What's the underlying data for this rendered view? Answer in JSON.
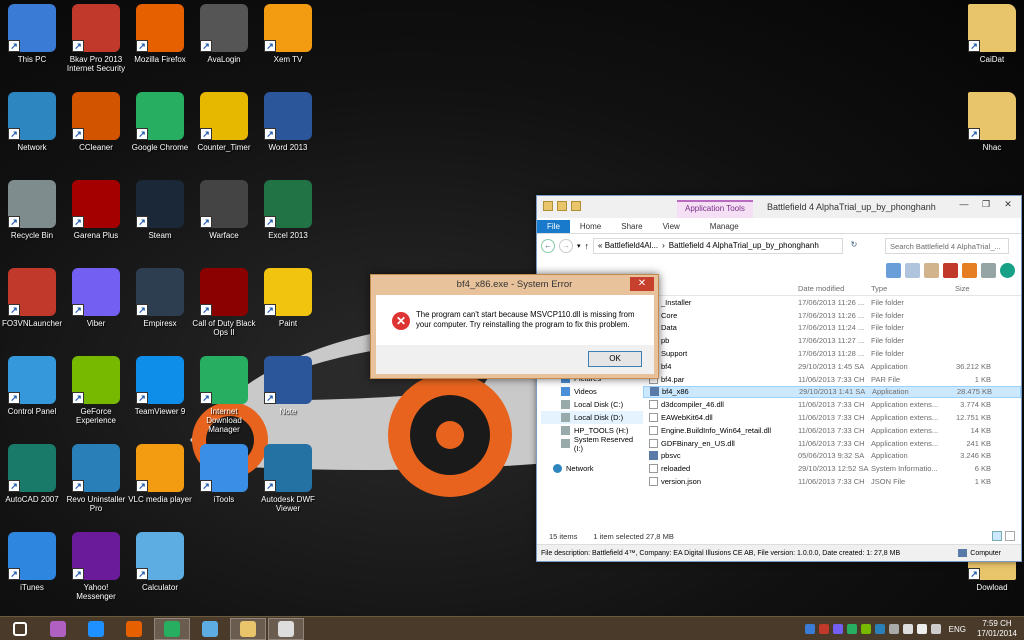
{
  "desktop_icons": [
    {
      "label": "This PC",
      "icon": "computer-icon",
      "color": "#3a7bd5"
    },
    {
      "label": "Bkav Pro 2013 Internet Security",
      "icon": "shield-icon",
      "color": "#c0392b"
    },
    {
      "label": "Mozilla Firefox",
      "icon": "firefox-icon",
      "color": "#e66000"
    },
    {
      "label": "AvaLogin",
      "icon": "avalogin-icon",
      "color": "#555555"
    },
    {
      "label": "Xem TV",
      "icon": "vlc-cone-icon",
      "color": "#f39c12"
    },
    {
      "label": "Network",
      "icon": "network-globe-icon",
      "color": "#2e86c1"
    },
    {
      "label": "CCleaner",
      "icon": "ccleaner-icon",
      "color": "#d35400"
    },
    {
      "label": "Google Chrome",
      "icon": "chrome-icon",
      "color": "#27ae60"
    },
    {
      "label": "Counter_Timer",
      "icon": "alarm-clock-icon",
      "color": "#e6b800"
    },
    {
      "label": "Word 2013",
      "icon": "word-icon",
      "color": "#2b579a"
    },
    {
      "label": "Recycle Bin",
      "icon": "recycle-bin-icon",
      "color": "#7f8c8d"
    },
    {
      "label": "Garena Plus",
      "icon": "garena-icon",
      "color": "#a50000"
    },
    {
      "label": "Steam",
      "icon": "steam-icon",
      "color": "#1b2838"
    },
    {
      "label": "Warface",
      "icon": "warface-icon",
      "color": "#444444"
    },
    {
      "label": "Excel 2013",
      "icon": "excel-icon",
      "color": "#217346"
    },
    {
      "label": "FO3VNLauncher",
      "icon": "fo3-icon",
      "color": "#c0392b"
    },
    {
      "label": "Viber",
      "icon": "viber-icon",
      "color": "#7360f2"
    },
    {
      "label": "Empiresx",
      "icon": "empires-icon",
      "color": "#2c3e50"
    },
    {
      "label": "Call of Duty Black Ops II",
      "icon": "cod-icon",
      "color": "#8b0000"
    },
    {
      "label": "Paint",
      "icon": "paint-palette-icon",
      "color": "#f1c40f"
    },
    {
      "label": "Control Panel",
      "icon": "control-panel-icon",
      "color": "#3498db"
    },
    {
      "label": "GeForce Experience",
      "icon": "geforce-icon",
      "color": "#76b900"
    },
    {
      "label": "TeamViewer 9",
      "icon": "teamviewer-icon",
      "color": "#0e8ee9"
    },
    {
      "label": "Internet Download Manager",
      "icon": "idm-icon",
      "color": "#27ae60"
    },
    {
      "label": "Note",
      "icon": "word-doc-icon",
      "color": "#2b579a"
    },
    {
      "label": "AutoCAD 2007",
      "icon": "autocad-icon",
      "color": "#1a7a6a"
    },
    {
      "label": "Revo Uninstaller Pro",
      "icon": "revo-icon",
      "color": "#2980b9"
    },
    {
      "label": "VLC media player",
      "icon": "vlc-cone-icon",
      "color": "#f39c12"
    },
    {
      "label": "iTools",
      "icon": "itools-icon",
      "color": "#3a8ee6"
    },
    {
      "label": "Autodesk DWF Viewer",
      "icon": "dwf-viewer-icon",
      "color": "#2471a3"
    },
    {
      "label": "iTunes",
      "icon": "itunes-icon",
      "color": "#2e86de"
    },
    {
      "label": "Yahoo! Messenger",
      "icon": "yahoo-icon",
      "color": "#6a1b9a"
    },
    {
      "label": "Calculator",
      "icon": "calculator-icon",
      "color": "#5dade2"
    },
    {
      "label": "CaiDat",
      "icon": "folder-icon",
      "color": "#e8c46a"
    },
    {
      "label": "Nhac",
      "icon": "folder-icon",
      "color": "#e8c46a"
    },
    {
      "label": "Dowload",
      "icon": "folder-icon",
      "color": "#e8c46a"
    }
  ],
  "explorer": {
    "title": "Battlefield 4 AlphaTrial_up_by_phonghanh",
    "app_tools_tab": "Application Tools",
    "tabs": [
      "File",
      "Home",
      "Share",
      "View",
      "Manage"
    ],
    "address": {
      "part1": "«  Battlefield4Al...",
      "sep": "›",
      "part2": "Battlefield 4 AlphaTrial_up_by_phonghanh"
    },
    "search_placeholder": "Search Battlefield 4 AlphaTrial_...",
    "columns": {
      "name": "me",
      "date": "Date modified",
      "type": "Type",
      "size": "Size"
    },
    "nav_items": [
      {
        "label": "Downloads",
        "selected": false
      },
      {
        "label": "Music",
        "selected": false
      },
      {
        "label": "Pictures",
        "selected": false
      },
      {
        "label": "Videos",
        "selected": false
      },
      {
        "label": "Local Disk (C:)",
        "selected": false
      },
      {
        "label": "Local Disk (D:)",
        "selected": true
      },
      {
        "label": "HP_TOOLS (H:)",
        "selected": false
      },
      {
        "label": "System Reserved (I:)",
        "selected": false
      }
    ],
    "network_label": "Network",
    "files": [
      {
        "name": "_Installer",
        "date": "17/06/2013 11:26 ...",
        "type": "File folder",
        "size": "",
        "kind": "folder"
      },
      {
        "name": "Core",
        "date": "17/06/2013 11:26 ...",
        "type": "File folder",
        "size": "",
        "kind": "folder"
      },
      {
        "name": "Data",
        "date": "17/06/2013 11:24 ...",
        "type": "File folder",
        "size": "",
        "kind": "folder"
      },
      {
        "name": "pb",
        "date": "17/06/2013 11:27 ...",
        "type": "File folder",
        "size": "",
        "kind": "folder"
      },
      {
        "name": "Support",
        "date": "17/06/2013 11:28 ...",
        "type": "File folder",
        "size": "",
        "kind": "folder"
      },
      {
        "name": "bf4",
        "date": "29/10/2013 1:45 SA",
        "type": "Application",
        "size": "36.212 KB",
        "kind": "app"
      },
      {
        "name": "bf4.par",
        "date": "11/06/2013 7:33 CH",
        "type": "PAR File",
        "size": "1 KB",
        "kind": "file"
      },
      {
        "name": "bf4_x86",
        "date": "29/10/2013 1:41 SA",
        "type": "Application",
        "size": "28.475 KB",
        "kind": "app"
      },
      {
        "name": "d3dcompiler_46.dll",
        "date": "11/06/2013 7:33 CH",
        "type": "Application extens...",
        "size": "3.774 KB",
        "kind": "file"
      },
      {
        "name": "EAWebKit64.dll",
        "date": "11/06/2013 7:33 CH",
        "type": "Application extens...",
        "size": "12.751 KB",
        "kind": "file"
      },
      {
        "name": "Engine.BuildInfo_Win64_retail.dll",
        "date": "11/06/2013 7:33 CH",
        "type": "Application extens...",
        "size": "14 KB",
        "kind": "file"
      },
      {
        "name": "GDFBinary_en_US.dll",
        "date": "11/06/2013 7:33 CH",
        "type": "Application extens...",
        "size": "241 KB",
        "kind": "file"
      },
      {
        "name": "pbsvc",
        "date": "05/06/2013 9:32 SA",
        "type": "Application",
        "size": "3.246 KB",
        "kind": "app"
      },
      {
        "name": "reloaded",
        "date": "29/10/2013 12:52 SA",
        "type": "System Informatio...",
        "size": "6 KB",
        "kind": "file"
      },
      {
        "name": "version.json",
        "date": "11/06/2013 7:33 CH",
        "type": "JSON File",
        "size": "1 KB",
        "kind": "file"
      }
    ],
    "selected_file": "bf4_x86",
    "status": {
      "items": "15 items",
      "selected": "1 item selected  27,8 MB"
    },
    "description": "File description: Battlefield 4™, Company: EA Digital Illusions CE AB, File version: 1.0.0.0, Date created: 1: 27,8 MB",
    "computer_label": "Computer"
  },
  "dialog": {
    "title": "bf4_x86.exe - System Error",
    "message": "The program can't start because MSVCP110.dll is missing from your computer. Try reinstalling the program to fix this problem.",
    "ok_label": "OK",
    "close_glyph": "✕"
  },
  "taskbar": {
    "apps": [
      {
        "icon": "start-windows-icon",
        "color": "#ffffff",
        "active": false
      },
      {
        "icon": "yahoo-taskbar-icon",
        "color": "#b060c0",
        "active": false
      },
      {
        "icon": "internet-explorer-icon",
        "color": "#1e90ff",
        "active": false
      },
      {
        "icon": "firefox-taskbar-icon",
        "color": "#e66000",
        "active": false
      },
      {
        "icon": "chrome-taskbar-icon",
        "color": "#27ae60",
        "active": true
      },
      {
        "icon": "calculator-taskbar-icon",
        "color": "#5dade2",
        "active": false
      },
      {
        "icon": "file-explorer-taskbar-icon",
        "color": "#e8c46a",
        "active": true
      },
      {
        "icon": "window-taskbar-icon",
        "color": "#dddddd",
        "active": true
      }
    ],
    "language": "ENG",
    "time": "7:59 CH",
    "date": "17/01/2014"
  }
}
